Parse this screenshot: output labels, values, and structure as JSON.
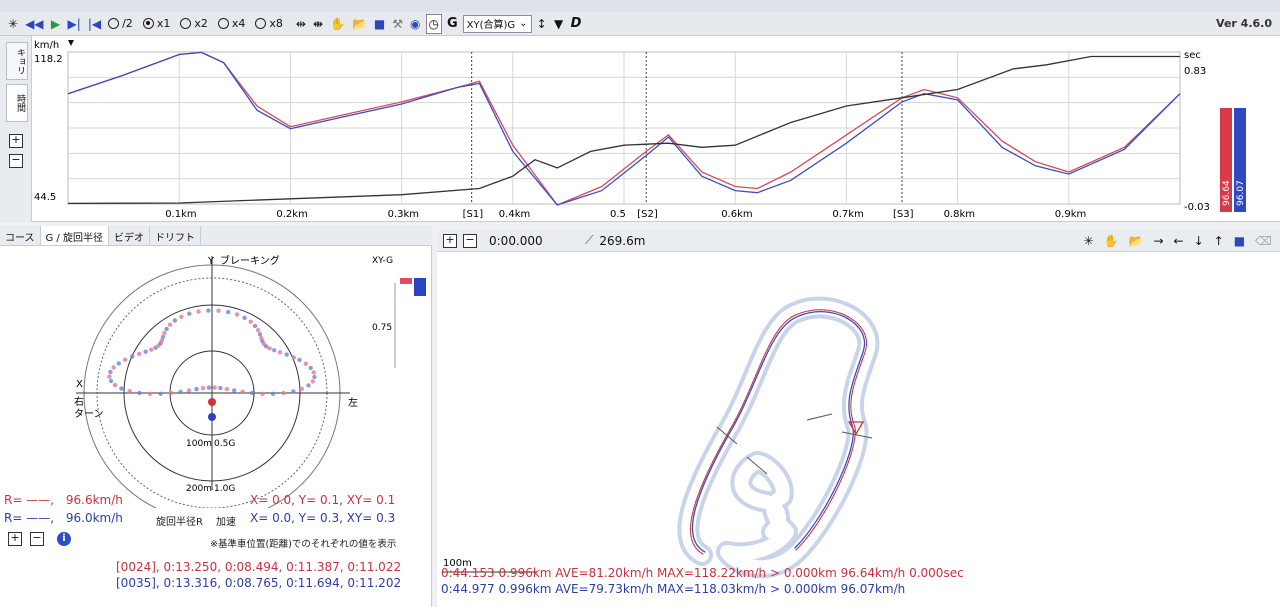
{
  "toolbar": {
    "rate_options": [
      {
        "label": "/2",
        "selected": false
      },
      {
        "label": "x1",
        "selected": true
      },
      {
        "label": "x2",
        "selected": false
      },
      {
        "label": "x4",
        "selected": false
      },
      {
        "label": "x8",
        "selected": false
      }
    ],
    "g_label": "G",
    "graph_select": "XY(合算)G",
    "d_label": "D",
    "version": "Ver 4.6.0"
  },
  "left_tabs": {
    "tab1": "キョリ",
    "tab2": "時間"
  },
  "chart_data": {
    "type": "line",
    "ylabel": "km/h",
    "y_top_label": "118.2",
    "y_bottom_label": "44.5",
    "ylim": [
      44.5,
      118.2
    ],
    "right_unit": "sec",
    "right_top_label": "0.83",
    "right_bottom_label": "-0.03",
    "xlim": [
      0,
      1.0
    ],
    "x_ticks": [
      {
        "x": 0.1,
        "label": "0.1km"
      },
      {
        "x": 0.2,
        "label": "0.2km"
      },
      {
        "x": 0.3,
        "label": "0.3km"
      },
      {
        "x": 0.4,
        "label": "0.4km"
      },
      {
        "x": 0.5,
        "label": "0.5"
      },
      {
        "x": 0.6,
        "label": "0.6km"
      },
      {
        "x": 0.7,
        "label": "0.7km"
      },
      {
        "x": 0.8,
        "label": "0.8km"
      },
      {
        "x": 0.9,
        "label": "0.9km"
      }
    ],
    "sectors": [
      {
        "x": 0.363,
        "label": "[S1]"
      },
      {
        "x": 0.52,
        "label": "[S2]"
      },
      {
        "x": 0.75,
        "label": "[S3]"
      }
    ],
    "series": [
      {
        "color": "#d84a5a",
        "x": [
          0,
          0.05,
          0.1,
          0.12,
          0.14,
          0.17,
          0.2,
          0.25,
          0.3,
          0.35,
          0.37,
          0.4,
          0.44,
          0.48,
          0.52,
          0.54,
          0.57,
          0.6,
          0.62,
          0.65,
          0.7,
          0.75,
          0.77,
          0.8,
          0.84,
          0.87,
          0.9,
          0.95,
          1.0
        ],
        "values": [
          98,
          107,
          117,
          118,
          113,
          92,
          82,
          88,
          94,
          101,
          104,
          73,
          44,
          53,
          70,
          78,
          60,
          53,
          52,
          60,
          78,
          96,
          100,
          96,
          75,
          65,
          60,
          72,
          98
        ]
      },
      {
        "color": "#3a4fc0",
        "x": [
          0,
          0.05,
          0.1,
          0.12,
          0.14,
          0.17,
          0.2,
          0.25,
          0.3,
          0.35,
          0.37,
          0.4,
          0.44,
          0.48,
          0.52,
          0.54,
          0.57,
          0.6,
          0.62,
          0.65,
          0.7,
          0.75,
          0.77,
          0.8,
          0.84,
          0.87,
          0.9,
          0.95,
          1.0
        ],
        "values": [
          98,
          107,
          117,
          118,
          113,
          90,
          81,
          87,
          93,
          101,
          103,
          70,
          44,
          51,
          68,
          77,
          58,
          51,
          50,
          56,
          74,
          94,
          98,
          95,
          72,
          63,
          59,
          71,
          98
        ]
      },
      {
        "color": "#333333",
        "x": [
          0,
          0.1,
          0.2,
          0.3,
          0.37,
          0.4,
          0.42,
          0.44,
          0.47,
          0.5,
          0.54,
          0.57,
          0.6,
          0.65,
          0.7,
          0.75,
          0.8,
          0.85,
          0.88,
          0.92,
          1.0
        ],
        "values": [
          44.8,
          45,
          47,
          49,
          52,
          58,
          66,
          62,
          70,
          73,
          74,
          72,
          73,
          84,
          92,
          96,
          100,
          110,
          112,
          116,
          116
        ]
      }
    ],
    "right_legend": [
      {
        "label": "96.64",
        "color": "#d83a4a"
      },
      {
        "label": "96.07",
        "color": "#3048c0"
      }
    ]
  },
  "g_panel": {
    "tabs": [
      "コース",
      "G / 旋回半径",
      "ビデオ",
      "ドリフト"
    ],
    "active_tab": "G / 旋回半径",
    "y_axis_label": "Y",
    "braking_label": "ブレーキング",
    "xy_g_label": "XY-G",
    "scale_label": "0.75",
    "left_x_label": "X",
    "left_label_1": "右",
    "left_label_2": "ターン",
    "right_label": "左",
    "ring_label_1": "100m",
    "ring_value_1": "0.5G",
    "ring_label_2": "200m",
    "ring_value_2": "1.0G",
    "row_red": {
      "prefix": "R= ——,",
      "speed": "96.6km/h",
      "xyz": "X=  0.0,  Y=  0.1,  XY= 0.1"
    },
    "row_blue": {
      "prefix": "R= ——,",
      "speed": "96.0km/h",
      "radius_label": "旋回半径R",
      "accel_label": "加速",
      "xyz": "X=  0.0,  Y=  0.3,  XY= 0.3"
    },
    "note": "※基準車位置(距離)でのそれぞれの値を表示",
    "lap_red": "[0024], 0:13.250, 0:08.494, 0:11.387, 0:11.022",
    "lap_blue": "[0035], 0:13.316, 0:08.765, 0:11.694, 0:11.202"
  },
  "map_panel": {
    "time": "0:00.000",
    "distance": "269.6m",
    "scale_label": "100m",
    "info_red": "0:44.153 0.996km AVE=81.20km/h MAX=118.22km/h > 0.000km 96.64km/h 0.000sec",
    "info_blue": "0:44.977 0.996km AVE=79.73km/h MAX=118.03km/h > 0.000km 96.07km/h"
  }
}
